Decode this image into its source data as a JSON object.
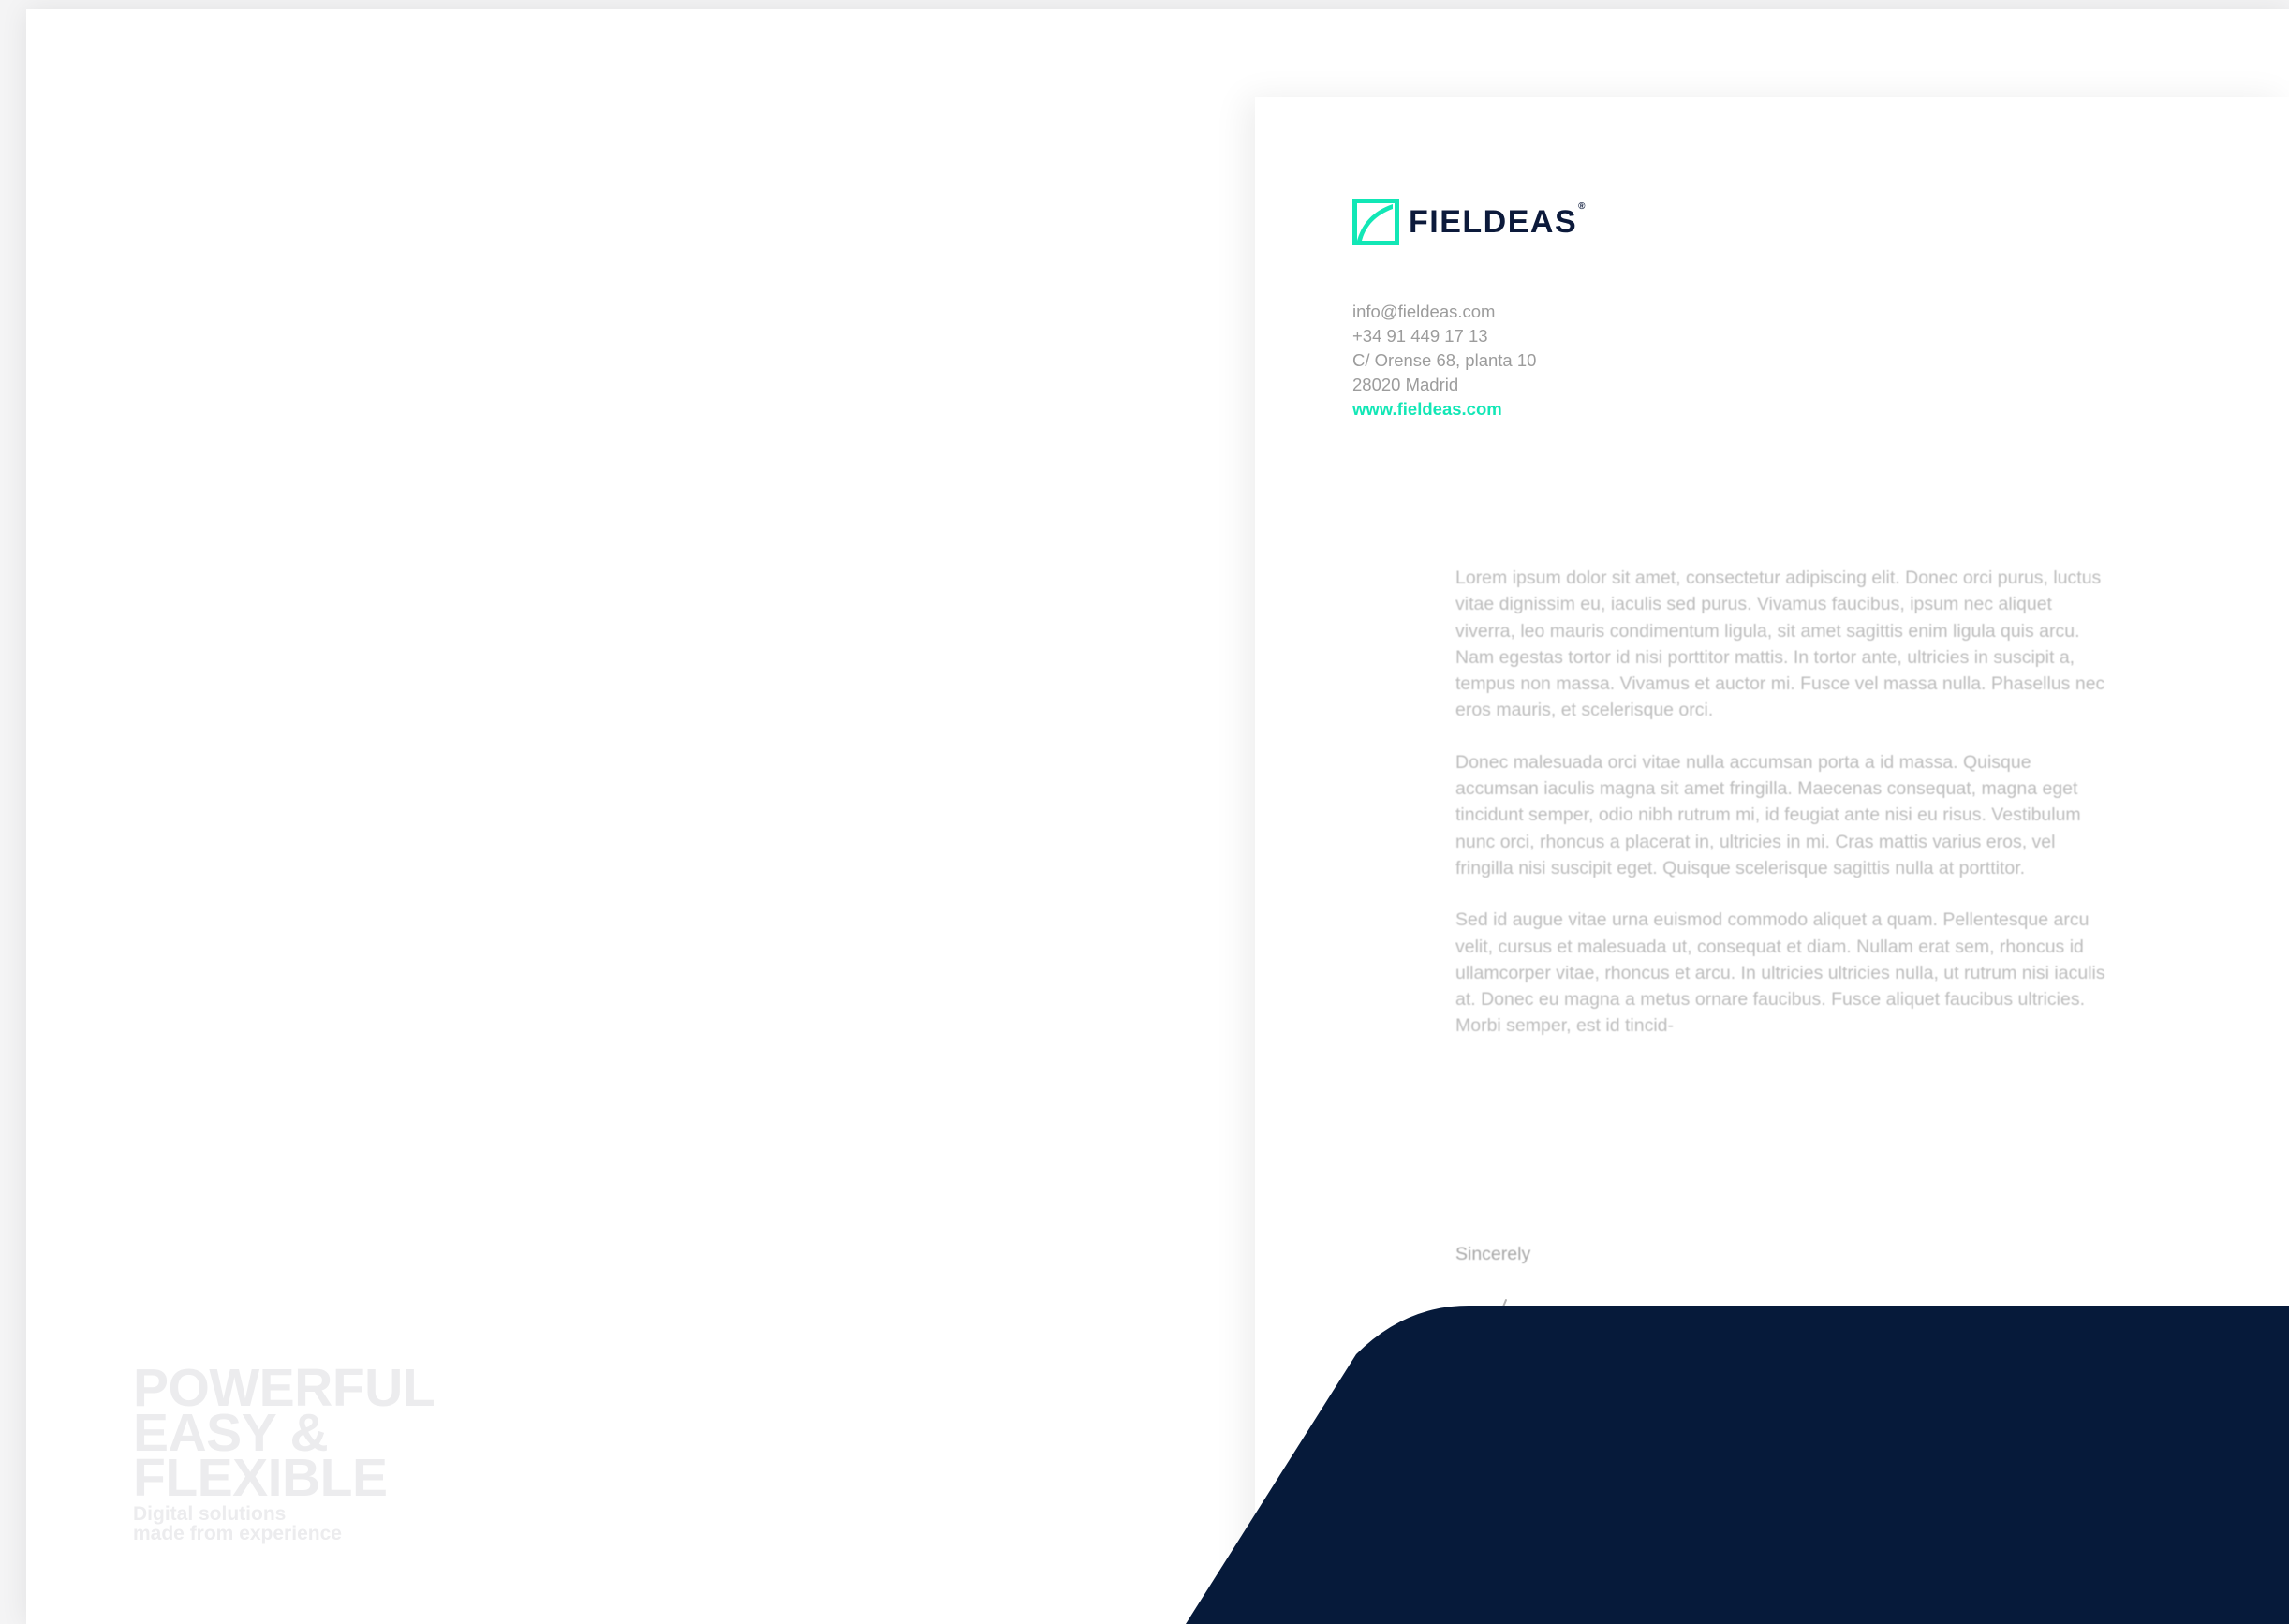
{
  "brand": {
    "name": "FIELDEAS",
    "registered_mark": "®",
    "accent_color": "#12e7b6",
    "navy_color": "#0c1a3b"
  },
  "contact": {
    "email": "info@fieldeas.com",
    "phone": "+34 91 449 17 13",
    "address_line1": "C/ Orense 68, planta 10",
    "address_line2": "28020 Madrid",
    "website": "www.fieldeas.com"
  },
  "letter": {
    "paragraphs": [
      "Lorem ipsum dolor sit amet, consectetur adipiscing elit. Donec orci purus, luctus vitae dignissim eu, iaculis sed purus. Vivamus faucibus, ipsum nec aliquet viverra, leo mauris condimentum ligula, sit amet sagittis enim ligula quis arcu. Nam egestas tortor id nisi porttitor mattis. In tortor ante, ultricies in suscipit a, tempus non massa. Vivamus et auctor mi. Fusce vel massa nulla. Phasellus nec eros mauris, et scelerisque orci.",
      "Donec malesuada orci vitae nulla accumsan porta a id massa. Quisque accumsan iaculis magna sit amet fringilla. Maecenas consequat, magna eget tincidunt semper, odio nibh rutrum mi, id feugiat ante nisi eu risus. Vestibulum nunc orci, rhoncus a placerat in, ultricies in mi. Cras mattis varius eros, vel fringilla nisi suscipit eget. Quisque scelerisque sagittis nulla at porttitor.",
      "Sed id augue vitae urna euismod commodo aliquet a quam. Pellentesque arcu velit, cursus et malesuada ut, consequat et diam. Nullam erat sem, rhoncus id ullamcorper vitae, rhoncus et arcu. In ultricies ultricies nulla, ut rutrum nisi iaculis at. Donec eu magna a metus ornare faucibus. Fusce aliquet faucibus ultricies. Morbi semper, est id tincid-"
    ],
    "closing": "Sincerely"
  },
  "tagline": {
    "headline": "POWERFUL\nEASY &\nFLEXIBLE",
    "subline": "Digital solutions\nmade from experience"
  }
}
